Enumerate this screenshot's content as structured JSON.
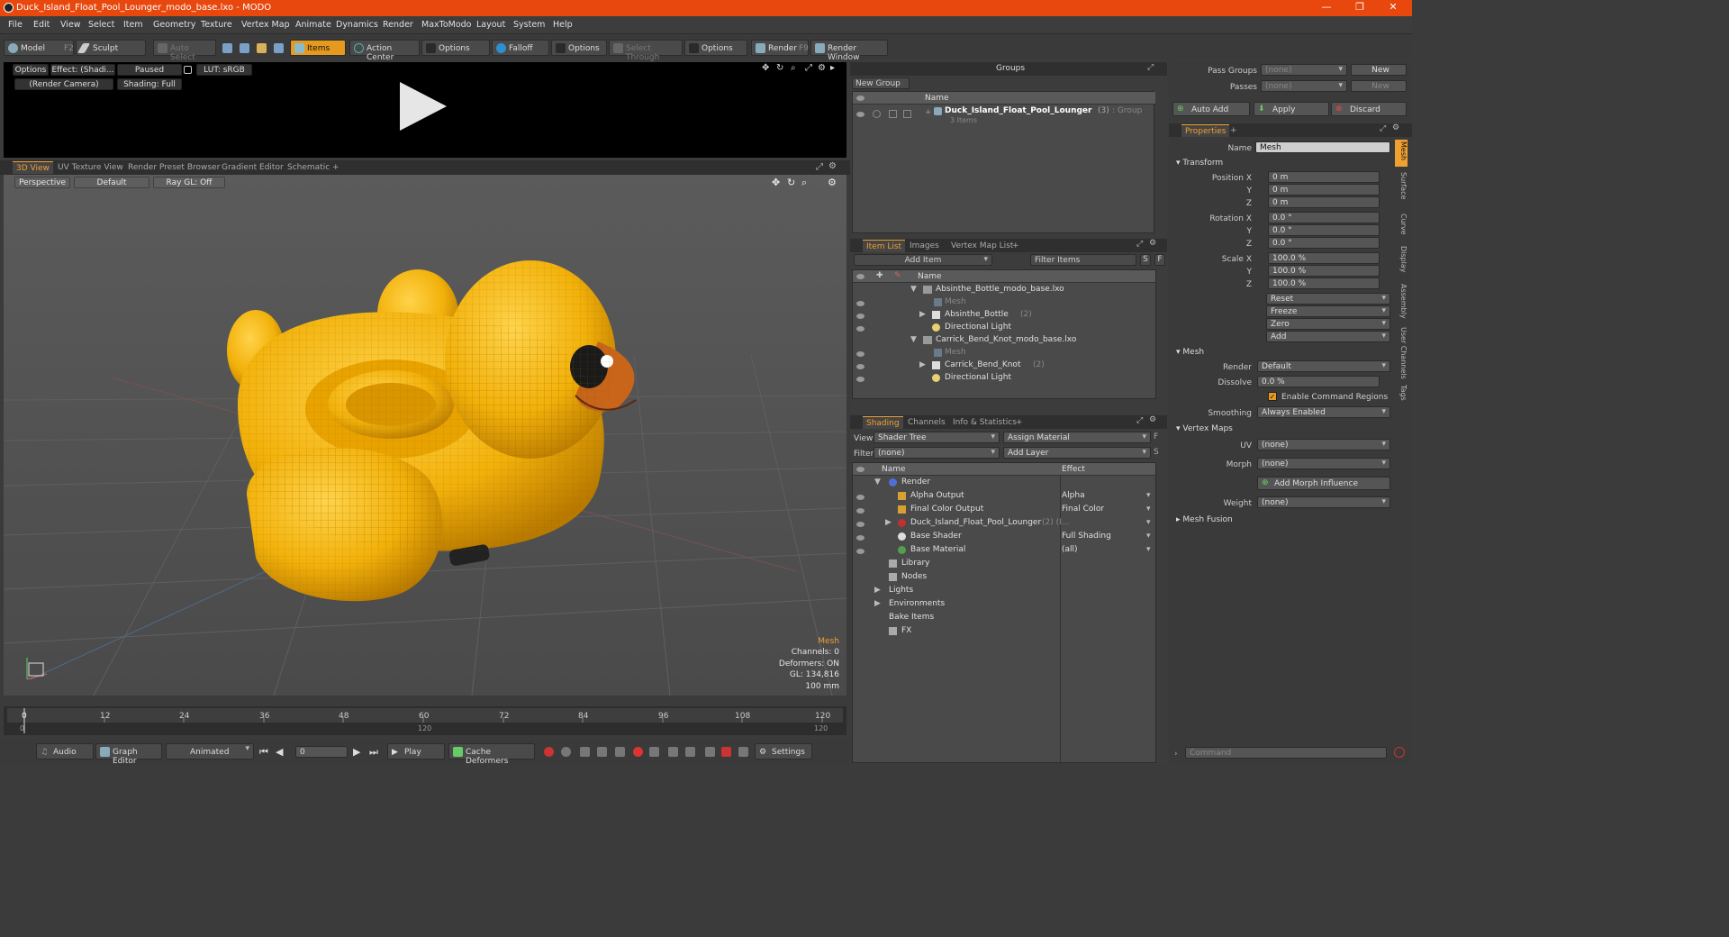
{
  "window": {
    "title": "Duck_Island_Float_Pool_Lounger_modo_base.lxo - MODO",
    "minimize": "—",
    "maximize": "❐",
    "close": "✕"
  },
  "menu": [
    "File",
    "Edit",
    "View",
    "Select",
    "Item",
    "Geometry",
    "Texture",
    "Vertex Map",
    "Animate",
    "Dynamics",
    "Render",
    "MaxToModo",
    "Layout",
    "System",
    "Help"
  ],
  "toolbar": {
    "model": "Model",
    "model_key": "F2",
    "sculpt": "Sculpt",
    "auto_select": "Auto Select",
    "items": "Items",
    "action_center": "Action Center",
    "options1": "Options",
    "falloff": "Falloff",
    "options2": "Options",
    "select_through": "Select Through",
    "options3": "Options",
    "render": "Render",
    "render_key": "F9",
    "render_window": "Render Window"
  },
  "preview": {
    "options": "Options",
    "effect": "Effect: (Shadi...",
    "paused": "Paused",
    "lut": "LUT: sRGB",
    "camera": "(Render Camera)",
    "shading": "Shading: Full"
  },
  "viewtabs": [
    "3D View",
    "UV Texture View",
    "Render Preset Browser",
    "Gradient Editor",
    "Schematic",
    "+"
  ],
  "viewport": {
    "perspective": "Perspective",
    "default": "Default",
    "raygl": "Ray GL: Off",
    "info": {
      "mesh": "Mesh",
      "channels": "Channels: 0",
      "deformers": "Deformers: ON",
      "gl": "GL: 134,816",
      "units": "100 mm"
    }
  },
  "timeline": {
    "ticks": [
      "0",
      "12",
      "24",
      "36",
      "48",
      "60",
      "72",
      "84",
      "96",
      "108",
      "120"
    ],
    "lower": [
      "0",
      "120",
      "120"
    ]
  },
  "transport": {
    "audio": "Audio",
    "graph_editor": "Graph Editor",
    "animated": "Animated",
    "frame": "0",
    "play": "Play",
    "cache_deformers": "Cache Deformers",
    "settings": "Settings"
  },
  "groups": {
    "title": "Groups",
    "new_group": "New Group",
    "col_name": "Name",
    "item_name": "Duck_Island_Float_Pool_Lounger",
    "item_count": "(3)",
    "item_type": ": Group",
    "item_sub": "3 Items"
  },
  "itemlist": {
    "tabs": [
      "Item List",
      "Images",
      "Vertex Map List",
      "+"
    ],
    "add_item": "Add Item",
    "filter_items": "Filter Items",
    "s": "S",
    "f": "F",
    "col_name": "Name",
    "rows": [
      {
        "label": "Absinthe_Bottle_modo_base.lxo",
        "indent": 0,
        "arrow": "▼"
      },
      {
        "label": "Mesh",
        "indent": 2,
        "dim": true
      },
      {
        "label": "Absinthe_Bottle",
        "suffix": "(2)",
        "indent": 1,
        "arrow": "▶"
      },
      {
        "label": "Directional Light",
        "indent": 1
      },
      {
        "label": "Carrick_Bend_Knot_modo_base.lxo",
        "indent": 0,
        "arrow": "▼"
      },
      {
        "label": "Mesh",
        "indent": 2,
        "dim": true
      },
      {
        "label": "Carrick_Bend_Knot",
        "suffix": "(2)",
        "indent": 1,
        "arrow": "▶"
      },
      {
        "label": "Directional Light",
        "indent": 1
      }
    ]
  },
  "shading": {
    "tabs": [
      "Shading",
      "Channels",
      "Info & Statistics",
      "+"
    ],
    "view_label": "View",
    "view_value": "Shader Tree",
    "assign_material": "Assign Material",
    "filter_label": "Filter",
    "filter_value": "(none)",
    "add_layer": "Add Layer",
    "col_name": "Name",
    "col_effect": "Effect",
    "rows": [
      {
        "name": "Render",
        "effect": "",
        "indent": 0,
        "arrow": "▼",
        "icon": "#4f6fd8"
      },
      {
        "name": "Alpha Output",
        "effect": "Alpha",
        "indent": 1,
        "icon": "#d8a030"
      },
      {
        "name": "Final Color Output",
        "effect": "Final Color",
        "indent": 1,
        "icon": "#d8a030"
      },
      {
        "name": "Duck_Island_Float_Pool_Lounger",
        "suffix": "(2) (I...",
        "effect": "",
        "indent": 1,
        "arrow": "▶",
        "icon": "#c03030"
      },
      {
        "name": "Base Shader",
        "effect": "Full Shading",
        "indent": 1,
        "icon": "#dddddd"
      },
      {
        "name": "Base Material",
        "effect": "(all)",
        "indent": 1,
        "icon": "#50a050"
      },
      {
        "name": "Library",
        "effect": "",
        "indent": 0,
        "icon": "#aaaaaa"
      },
      {
        "name": "Nodes",
        "effect": "",
        "indent": 0,
        "icon": "#aaaaaa"
      },
      {
        "name": "Lights",
        "effect": "",
        "indent": 0,
        "arrow": "▶"
      },
      {
        "name": "Environments",
        "effect": "",
        "indent": 0,
        "arrow": "▶"
      },
      {
        "name": "Bake Items",
        "effect": "",
        "indent": 0
      },
      {
        "name": "FX",
        "effect": "",
        "indent": 0,
        "icon": "#aaaaaa"
      }
    ]
  },
  "passes": {
    "pass_groups_label": "Pass Groups",
    "pass_groups_value": "(none)",
    "new1": "New",
    "passes_label": "Passes",
    "passes_value": "(none)",
    "new2": "New",
    "auto_add": "Auto Add",
    "apply": "Apply",
    "discard": "Discard"
  },
  "properties": {
    "tab": "Properties",
    "plus": "+",
    "name_label": "Name",
    "name_value": "Mesh",
    "transform": "Transform",
    "position": [
      {
        "label": "Position X",
        "value": "0 m"
      },
      {
        "label": "Y",
        "value": "0 m"
      },
      {
        "label": "Z",
        "value": "0 m"
      }
    ],
    "rotation": [
      {
        "label": "Rotation X",
        "value": "0.0 °"
      },
      {
        "label": "Y",
        "value": "0.0 °"
      },
      {
        "label": "Z",
        "value": "0.0 °"
      }
    ],
    "scale": [
      {
        "label": "Scale X",
        "value": "100.0 %"
      },
      {
        "label": "Y",
        "value": "100.0 %"
      },
      {
        "label": "Z",
        "value": "100.0 %"
      }
    ],
    "actions": [
      "Reset",
      "Freeze",
      "Zero",
      "Add"
    ],
    "mesh_section": "Mesh",
    "render_label": "Render",
    "render_value": "Default",
    "dissolve_label": "Dissolve",
    "dissolve_value": "0.0 %",
    "enable_cmd": "Enable Command Regions",
    "smoothing_label": "Smoothing",
    "smoothing_value": "Always Enabled",
    "vmaps_section": "Vertex Maps",
    "uv_label": "UV",
    "uv_value": "(none)",
    "morph_label": "Morph",
    "morph_value": "(none)",
    "add_morph": "Add Morph Influence",
    "weight_label": "Weight",
    "weight_value": "(none)",
    "mesh_fusion": "Mesh Fusion",
    "sidetabs": [
      "Mesh",
      "Surface",
      "Curve",
      "Display",
      "Assembly",
      "User Channels",
      "Tags"
    ]
  },
  "command": {
    "placeholder": "Command"
  }
}
